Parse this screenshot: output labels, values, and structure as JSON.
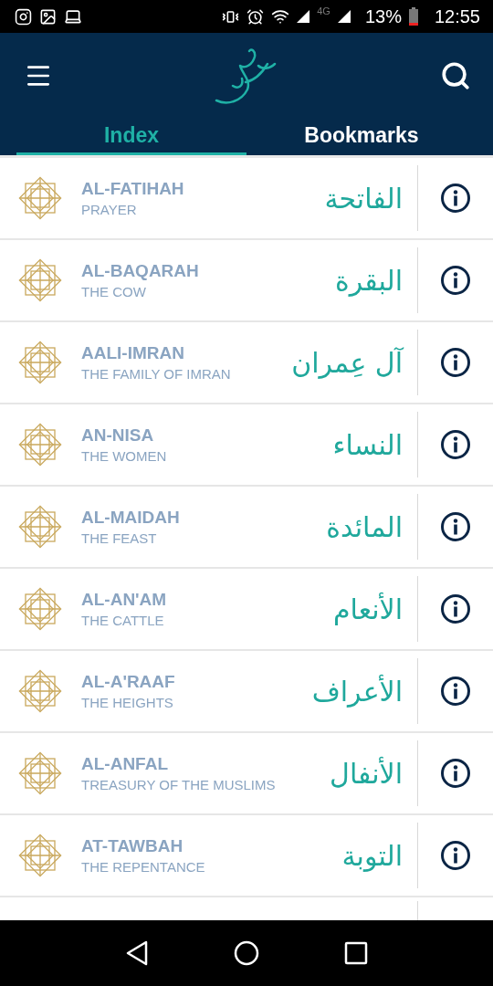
{
  "status_bar": {
    "network": "4G",
    "battery": "13%",
    "time": "12:55"
  },
  "tabs": [
    {
      "label": "Index",
      "selected": true
    },
    {
      "label": "Bookmarks",
      "selected": false
    }
  ],
  "surahs": [
    {
      "name": "AL-FATIHAH",
      "meaning": "PRAYER",
      "arabic": "الفاتحة"
    },
    {
      "name": "AL-BAQARAH",
      "meaning": "THE COW",
      "arabic": "البقرة"
    },
    {
      "name": "AALI-IMRAN",
      "meaning": "THE FAMILY OF IMRAN",
      "arabic": "آل عِمران"
    },
    {
      "name": "AN-NISA",
      "meaning": "THE WOMEN",
      "arabic": "النساء"
    },
    {
      "name": "AL-MAIDAH",
      "meaning": "THE FEAST",
      "arabic": "المائدة"
    },
    {
      "name": "AL-AN'AM",
      "meaning": "THE CATTLE",
      "arabic": "الأنعام"
    },
    {
      "name": "AL-A'RAAF",
      "meaning": "THE HEIGHTS",
      "arabic": "الأعراف"
    },
    {
      "name": "AL-ANFAL",
      "meaning": "TREASURY OF THE MUSLIMS",
      "arabic": "الأنفال"
    },
    {
      "name": "AT-TAWBAH",
      "meaning": "THE REPENTANCE",
      "arabic": "التوبة"
    }
  ]
}
